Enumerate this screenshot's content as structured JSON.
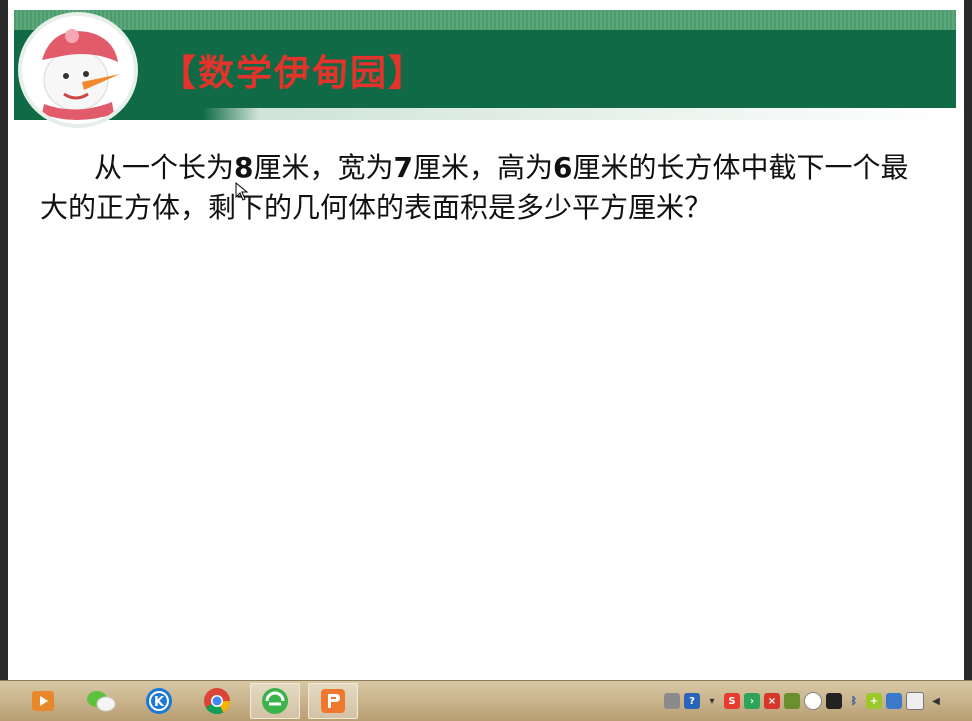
{
  "slide": {
    "header_title": "【数学伊甸园】",
    "question": {
      "part1": "从一个长为",
      "num1": "8",
      "part2": "厘米，宽为",
      "num2": "7",
      "part3": "厘米，高为",
      "num3": "6",
      "part4": "厘米的长方体中截下一个最大的正方体，剩下的几何体的表面积是多少平方厘米？"
    }
  },
  "colors": {
    "header_green": "#0f6a45",
    "title_red": "#e4332b",
    "taskbar": "#c9b38a"
  },
  "taskbar": {
    "apps": [
      {
        "icon": "media-player-icon"
      },
      {
        "icon": "wechat-icon"
      },
      {
        "icon": "kugou-icon"
      },
      {
        "icon": "chrome-icon"
      },
      {
        "icon": "browser-360-icon"
      },
      {
        "icon": "presentation-icon"
      }
    ],
    "tray_icons": [
      "keyboard-icon",
      "help-icon",
      "arrow-icon",
      "sogou-icon",
      "green-arrow-icon",
      "red-x-icon",
      "shield-icon",
      "circle-icon",
      "penguin-icon",
      "bluetooth-icon",
      "plus-icon",
      "network-icon",
      "wifi-icon",
      "volume-icon"
    ]
  }
}
